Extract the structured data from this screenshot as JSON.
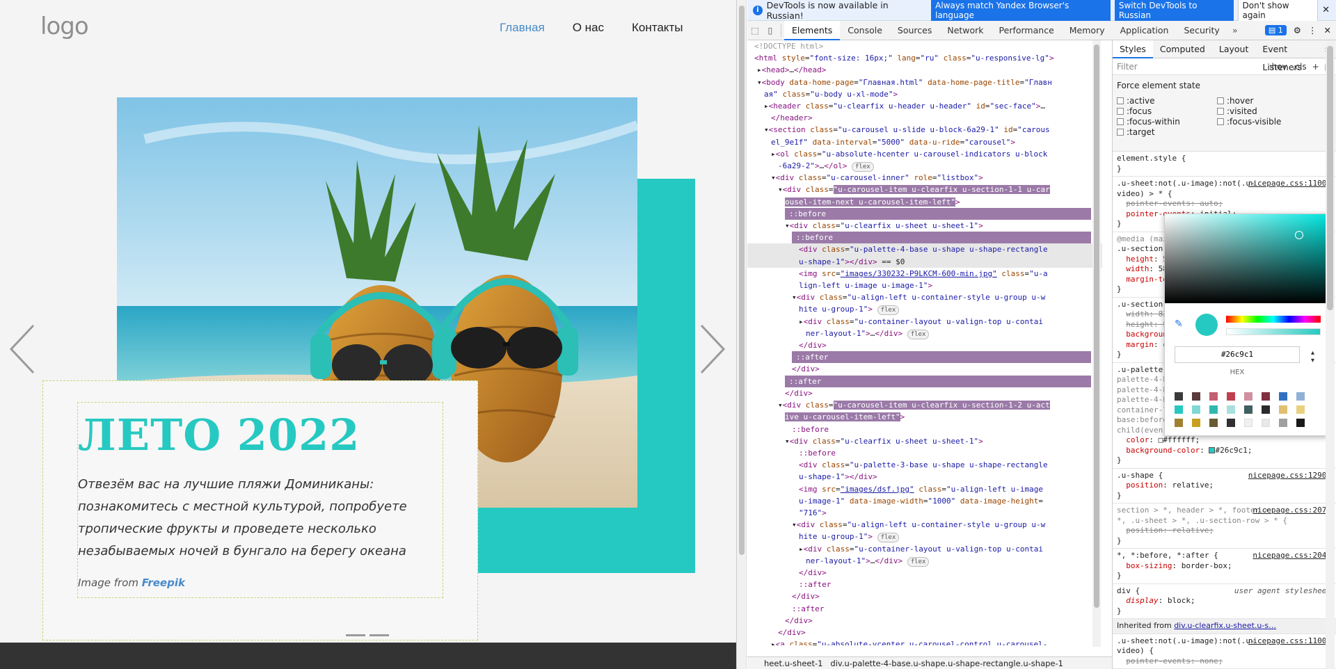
{
  "site": {
    "logo": "logo",
    "nav": [
      "Главная",
      "О нас",
      "Контакты"
    ],
    "hero_title": "ЛЕТО 2022",
    "hero_text": "Отвезём вас на лучшие пляжи Доминиканы: познакомитесь с местной культурой, попробуете тропические фрукты и проведете несколько незабываемых ночей в бунгало на берегу океана",
    "credit_prefix": "Image from ",
    "credit_link": "Freepik",
    "accent": "#26c9c1"
  },
  "devtools": {
    "info_message": "DevTools is now available in Russian!",
    "btn_match": "Always match Yandex Browser's language",
    "btn_switch": "Switch DevTools to Russian",
    "btn_dont": "Don't show again",
    "tabs": [
      "Elements",
      "Console",
      "Sources",
      "Network",
      "Performance",
      "Memory",
      "Application",
      "Security"
    ],
    "issues_count": "1",
    "styles_tabs": [
      "Styles",
      "Computed",
      "Layout",
      "Event Listeners"
    ],
    "filter_placeholder": "Filter",
    "hov": ":hov",
    "cls": ".cls",
    "force_header": "Force element state",
    "force_states": [
      ":active",
      ":hover",
      ":focus",
      ":visited",
      ":focus-within",
      ":focus-visible",
      ":target"
    ],
    "element_style": "element.style {",
    "breadcrumb_1": "heet.u-sheet-1",
    "breadcrumb_2": "div.u-palette-4-base.u-shape.u-shape-rectangle.u-shape-1",
    "picker": {
      "hex": "#26c9c1",
      "label": "HEX",
      "color": "#26c9c1"
    },
    "inherited": "Inherited from",
    "inherited_from": "div.u-clearfix.u-sheet.u-s…"
  }
}
